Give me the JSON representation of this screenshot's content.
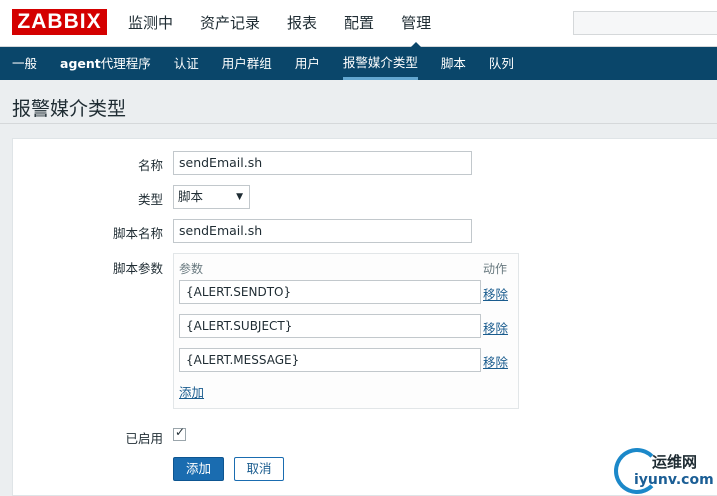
{
  "header": {
    "logo": "ZABBIX",
    "nav": [
      "监测中",
      "资产记录",
      "报表",
      "配置",
      "管理"
    ],
    "active_nav": "管理"
  },
  "subnav": {
    "items": [
      {
        "label": "一般"
      },
      {
        "label_strong": "agent",
        "label": "代理程序"
      },
      {
        "label": "认证"
      },
      {
        "label": "用户群组"
      },
      {
        "label": "用户"
      },
      {
        "label": "报警媒介类型"
      },
      {
        "label": "脚本"
      },
      {
        "label": "队列"
      }
    ],
    "active": "报警媒介类型"
  },
  "page": {
    "title": "报警媒介类型"
  },
  "form": {
    "name_label": "名称",
    "name_value": "sendEmail.sh",
    "type_label": "类型",
    "type_value": "脚本",
    "script_name_label": "脚本名称",
    "script_name_value": "sendEmail.sh",
    "script_params_label": "脚本参数",
    "params_header": "参数",
    "action_header": "动作",
    "params": [
      {
        "value": "{ALERT.SENDTO}",
        "remove": "移除"
      },
      {
        "value": "{ALERT.SUBJECT}",
        "remove": "移除"
      },
      {
        "value": "{ALERT.MESSAGE}",
        "remove": "移除"
      }
    ],
    "add_param": "添加",
    "enabled_label": "已启用",
    "enabled": true,
    "submit": "添加",
    "cancel": "取消"
  },
  "watermark": {
    "line1": "运维网",
    "line2": "iyunv.com"
  },
  "colors": {
    "brand": "#d40000",
    "subnav": "#0a466a",
    "button": "#1a6cb0",
    "link": "#1a5c8e"
  }
}
